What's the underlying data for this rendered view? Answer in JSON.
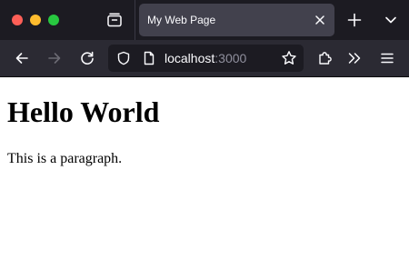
{
  "tab": {
    "title": "My Web Page"
  },
  "address_bar": {
    "host": "localhost",
    "port": ":3000"
  },
  "page": {
    "heading": "Hello World",
    "paragraph": "This is a paragraph."
  },
  "icons": {
    "tab_view": "tab-view-icon",
    "tab_close": "close-icon",
    "new_tab": "plus-icon",
    "tab_list": "chevron-down-icon",
    "back": "arrow-left-icon",
    "forward": "arrow-right-icon",
    "reload": "reload-icon",
    "tracking_protection": "shield-icon",
    "page_info": "page-icon",
    "bookmark": "star-icon",
    "extensions": "puzzle-icon",
    "overflow": "chevrons-right-icon",
    "menu": "hamburger-icon"
  },
  "colors": {
    "tabstrip_bg": "#1c1b22",
    "active_tab_bg": "#42414d",
    "navbar_bg": "#2b2a33",
    "urlbar_bg": "#1c1b22",
    "traffic_close": "#fe5f57",
    "traffic_minimize": "#febc2e",
    "traffic_maximize": "#28c840"
  }
}
